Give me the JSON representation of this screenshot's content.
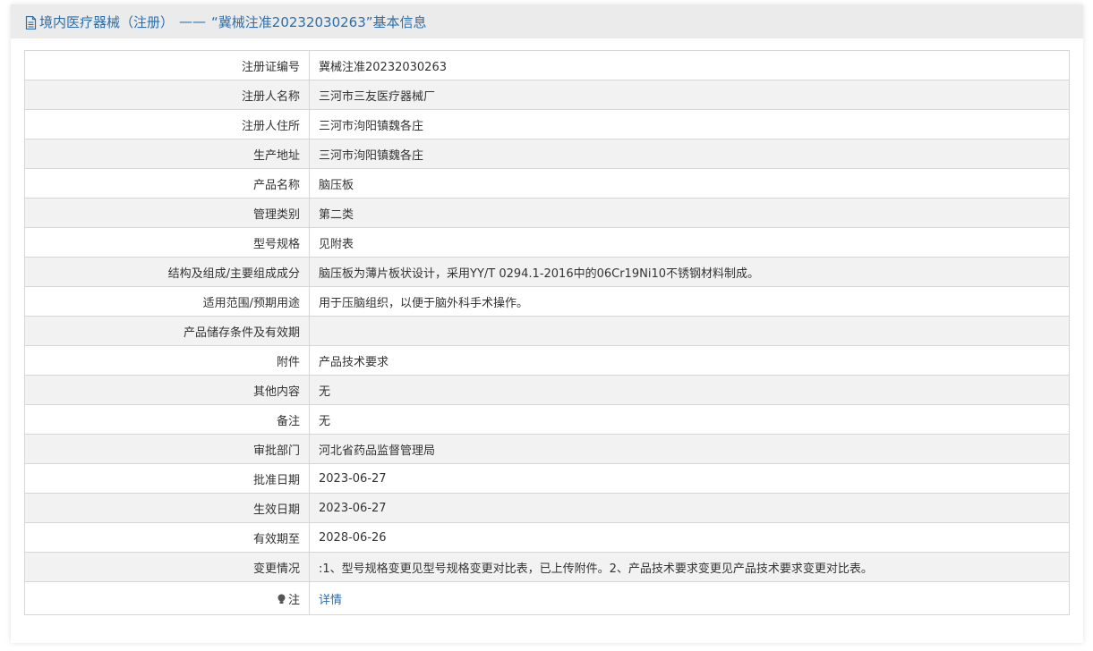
{
  "header": {
    "category": "境内医疗器械（注册）",
    "separator": "——",
    "title": "“冀械注准20232030263”基本信息"
  },
  "rows": [
    {
      "label": "注册证编号",
      "value": "冀械注准20232030263"
    },
    {
      "label": "注册人名称",
      "value": "三河市三友医疗器械厂"
    },
    {
      "label": "注册人住所",
      "value": "三河市泃阳镇魏各庄"
    },
    {
      "label": "生产地址",
      "value": "三河市泃阳镇魏各庄"
    },
    {
      "label": "产品名称",
      "value": "脑压板"
    },
    {
      "label": "管理类别",
      "value": "第二类"
    },
    {
      "label": "型号规格",
      "value": "见附表"
    },
    {
      "label": "结构及组成/主要组成成分",
      "value": "脑压板为薄片板状设计，采用YY/T 0294.1-2016中的06Cr19Ni10不锈钢材料制成。"
    },
    {
      "label": "适用范围/预期用途",
      "value": "用于压脑组织，以便于脑外科手术操作。"
    },
    {
      "label": "产品储存条件及有效期",
      "value": ""
    },
    {
      "label": "附件",
      "value": "产品技术要求"
    },
    {
      "label": "其他内容",
      "value": "无"
    },
    {
      "label": "备注",
      "value": "无"
    },
    {
      "label": "审批部门",
      "value": "河北省药品监督管理局"
    },
    {
      "label": "批准日期",
      "value": "2023-06-27"
    },
    {
      "label": "生效日期",
      "value": "2023-06-27"
    },
    {
      "label": "有效期至",
      "value": "2028-06-26"
    },
    {
      "label": "变更情况",
      "value": ":1、型号规格变更见型号规格变更对比表，已上传附件。2、产品技术要求变更见产品技术要求变更对比表。"
    }
  ],
  "note": {
    "label": "注",
    "icon": "lightbulb-icon",
    "link_text": "详情"
  },
  "colors": {
    "accent": "#2d6ea8",
    "header_bg": "#ebebeb",
    "row_alt_bg": "#f2f2f2",
    "border": "#d6d6d6"
  }
}
